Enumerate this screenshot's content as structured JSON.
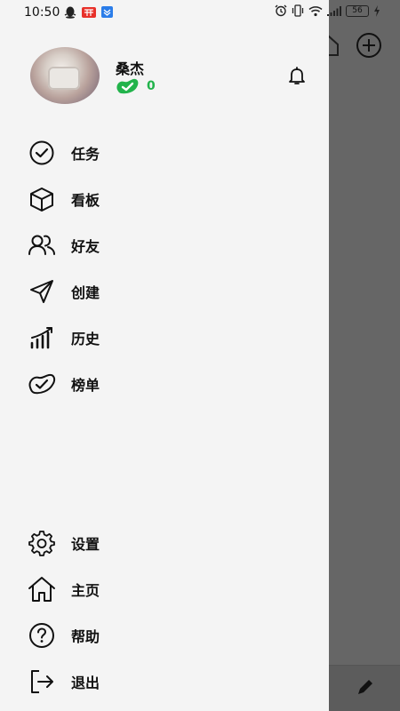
{
  "status_bar": {
    "time": "10:50",
    "battery": "56"
  },
  "profile": {
    "username": "桑杰",
    "checkin_count": "0"
  },
  "menu": {
    "items": [
      {
        "label": "任务",
        "icon": "task-check-icon"
      },
      {
        "label": "看板",
        "icon": "cube-icon"
      },
      {
        "label": "好友",
        "icon": "friends-icon"
      },
      {
        "label": "创建",
        "icon": "send-icon"
      },
      {
        "label": "历史",
        "icon": "bar-chart-icon"
      },
      {
        "label": "榜单",
        "icon": "bean-check-icon"
      }
    ],
    "bottom_items": [
      {
        "label": "设置",
        "icon": "gear-icon"
      },
      {
        "label": "主页",
        "icon": "home-icon"
      },
      {
        "label": "帮助",
        "icon": "help-icon"
      },
      {
        "label": "退出",
        "icon": "logout-icon"
      }
    ]
  },
  "colors": {
    "accent_green": "#22b34b",
    "drawer_bg": "#f4f4f4",
    "overlay": "#666666"
  }
}
